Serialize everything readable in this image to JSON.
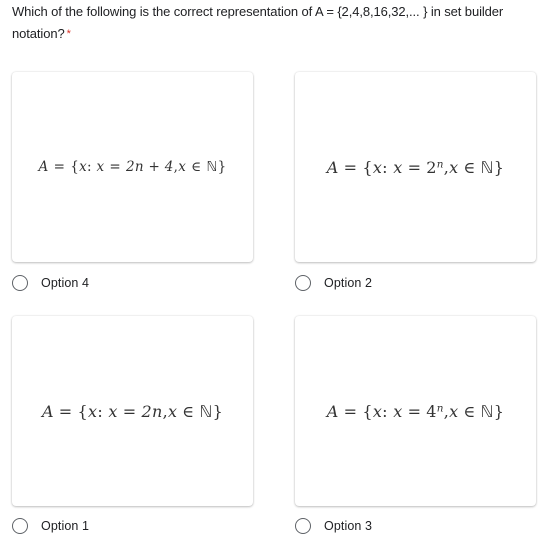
{
  "question": {
    "text": "Which of the following is the correct representation of A = {2,4,8,16,32,... } in set builder notation?",
    "required_marker": "*"
  },
  "options": [
    {
      "label": "Option 4",
      "formula": {
        "lhs": "A",
        "eq": "=",
        "open": "{",
        "var": "x",
        "colon": ":",
        "var2": "x",
        "eq2": "=",
        "expr_base": "2n + 4",
        "expr_sup": "",
        "comma": ",",
        "var3": "x",
        "in": "∈",
        "set": "ℕ",
        "close": "}"
      },
      "selected": false
    },
    {
      "label": "Option 2",
      "formula": {
        "lhs": "A",
        "eq": "=",
        "open": "{",
        "var": "x",
        "colon": ":",
        "var2": "x",
        "eq2": "=",
        "expr_base": "2",
        "expr_sup": "n",
        "comma": ",",
        "var3": "x",
        "in": "∈",
        "set": "ℕ",
        "close": "}"
      },
      "selected": false
    },
    {
      "label": "Option 1",
      "formula": {
        "lhs": "A",
        "eq": "=",
        "open": "{",
        "var": "x",
        "colon": ":",
        "var2": "x",
        "eq2": "=",
        "expr_base": "2n",
        "expr_sup": "",
        "comma": ",",
        "var3": "x",
        "in": "∈",
        "set": "ℕ",
        "close": "}"
      },
      "selected": false
    },
    {
      "label": "Option 3",
      "formula": {
        "lhs": "A",
        "eq": "=",
        "open": "{",
        "var": "x",
        "colon": ":",
        "var2": "x",
        "eq2": "=",
        "expr_base": "4",
        "expr_sup": "n",
        "comma": ",",
        "var3": "x",
        "in": "∈",
        "set": "ℕ",
        "close": "}"
      },
      "selected": false
    }
  ],
  "colors": {
    "text": "#202124",
    "required": "#d93025",
    "radio_border": "#5f6368",
    "formula_text": "#333333"
  }
}
